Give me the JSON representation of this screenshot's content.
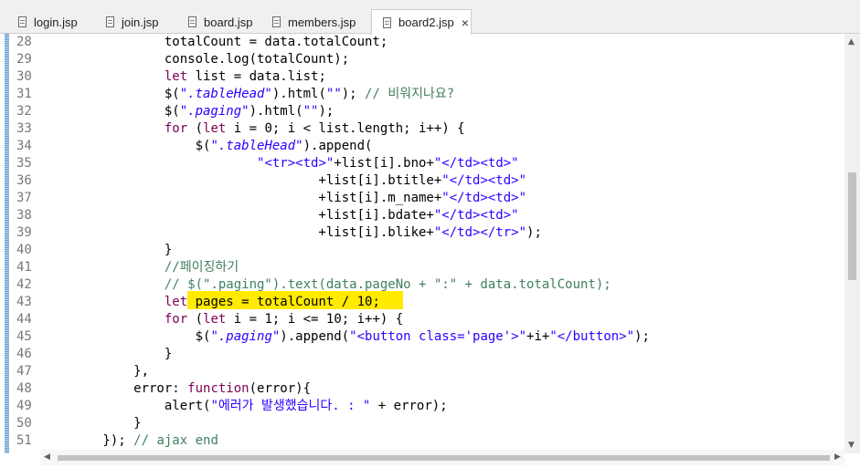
{
  "tabs": [
    {
      "label": "login.jsp"
    },
    {
      "label": "join.jsp"
    },
    {
      "label": "board.jsp"
    },
    {
      "label": "members.jsp"
    },
    {
      "label": "board2.jsp",
      "active": true,
      "close": "×"
    }
  ],
  "colors": {
    "keyword": "#7f0055",
    "string": "#2a00ff",
    "comment": "#3f7f5f",
    "highlight": "#ffea00",
    "line_number": "#787878"
  },
  "editor": {
    "lines": [
      {
        "n": "28",
        "t": "                totalCount = data.totalCount;"
      },
      {
        "n": "29",
        "t": "                console.log(totalCount);"
      },
      {
        "n": "30",
        "t": "                let list = data.list;"
      },
      {
        "n": "31",
        "t": "                $(\".tableHead\").html(\"\"); // 비워지나요?"
      },
      {
        "n": "32",
        "t": "                $(\".paging\").html(\"\");"
      },
      {
        "n": "33",
        "t": "                for (let i = 0; i < list.length; i++) {"
      },
      {
        "n": "34",
        "t": "                    $(\".tableHead\").append("
      },
      {
        "n": "35",
        "t": "                            \"<tr><td>\"+list[i].bno+\"</td><td>\""
      },
      {
        "n": "36",
        "t": "                                    +list[i].btitle+\"</td><td>\""
      },
      {
        "n": "37",
        "t": "                                    +list[i].m_name+\"</td><td>\""
      },
      {
        "n": "38",
        "t": "                                    +list[i].bdate+\"</td><td>\""
      },
      {
        "n": "39",
        "t": "                                    +list[i].blike+\"</td></tr>\");"
      },
      {
        "n": "40",
        "t": "                }"
      },
      {
        "n": "41",
        "t": "                //페이징하기"
      },
      {
        "n": "42",
        "t": "                // $(\".paging\").text(data.pageNo + \":\" + data.totalCount);"
      },
      {
        "n": "43",
        "t": "                let pages = totalCount / 10;"
      },
      {
        "n": "44",
        "t": "                for (let i = 1; i <= 10; i++) {"
      },
      {
        "n": "45",
        "t": "                    $(\".paging\").append(\"<button class='page'>\"+i+\"</button>\");"
      },
      {
        "n": "46",
        "t": "                }"
      },
      {
        "n": "47",
        "t": "            },"
      },
      {
        "n": "48",
        "t": "            error: function(error){"
      },
      {
        "n": "49",
        "t": "                alert(\"에러가 발생했습니다. : \" + error);"
      },
      {
        "n": "50",
        "t": "            }"
      },
      {
        "n": "51",
        "t": "        }); // ajax end"
      }
    ]
  }
}
